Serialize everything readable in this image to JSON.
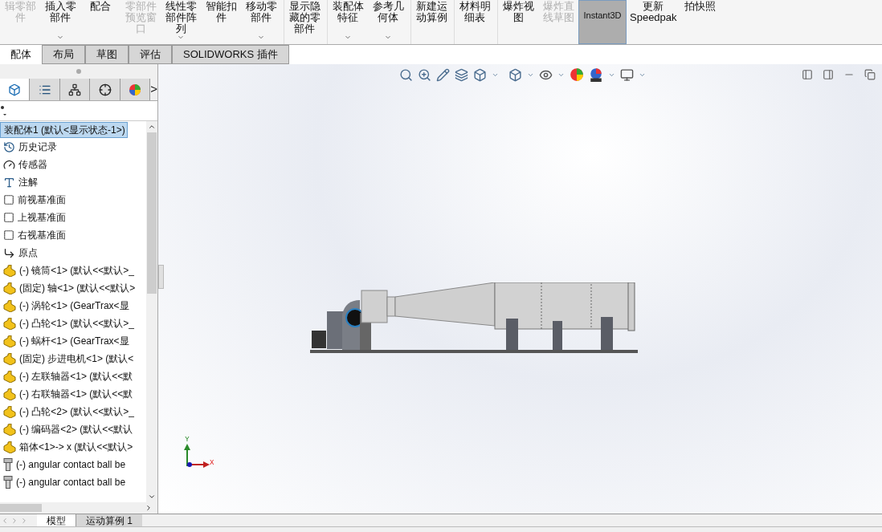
{
  "ribbon": [
    {
      "label": "辑零部件",
      "disabled": true,
      "dropdown": false,
      "selected": false
    },
    {
      "label": "插入零部件",
      "disabled": false,
      "dropdown": true,
      "selected": false
    },
    {
      "label": "配合",
      "disabled": false,
      "dropdown": false,
      "selected": false
    },
    {
      "label": "零部件预览窗口",
      "disabled": true,
      "dropdown": false,
      "selected": false
    },
    {
      "label": "线性零部件阵列",
      "disabled": false,
      "dropdown": true,
      "selected": false
    },
    {
      "label": "智能扣件",
      "disabled": false,
      "dropdown": false,
      "selected": false
    },
    {
      "label": "移动零部件",
      "disabled": false,
      "dropdown": true,
      "selected": false
    },
    {
      "label": "显示隐藏的零部件",
      "disabled": false,
      "dropdown": false,
      "selected": false
    },
    {
      "label": "装配体特征",
      "disabled": false,
      "dropdown": true,
      "selected": false
    },
    {
      "label": "参考几何体",
      "disabled": false,
      "dropdown": true,
      "selected": false
    },
    {
      "label": "新建运动算例",
      "disabled": false,
      "dropdown": false,
      "selected": false
    },
    {
      "label": "材料明细表",
      "disabled": false,
      "dropdown": false,
      "selected": false
    },
    {
      "label": "爆炸视图",
      "disabled": false,
      "dropdown": false,
      "selected": false
    },
    {
      "label": "爆炸直线草图",
      "disabled": true,
      "dropdown": false,
      "selected": false
    },
    {
      "label": "Instant3D",
      "disabled": false,
      "dropdown": false,
      "selected": true
    },
    {
      "label": "更新Speedpak",
      "disabled": false,
      "dropdown": false,
      "selected": false
    },
    {
      "label": "拍快照",
      "disabled": false,
      "dropdown": false,
      "selected": false
    }
  ],
  "tabs": [
    {
      "label": "配体",
      "selected": true
    },
    {
      "label": "布局",
      "selected": false
    },
    {
      "label": "草图",
      "selected": false
    },
    {
      "label": "评估",
      "selected": false
    },
    {
      "label": "SOLIDWORKS 插件",
      "selected": false
    }
  ],
  "panel_tabs": [
    {
      "kind": "tree",
      "selected": true
    },
    {
      "kind": "property",
      "selected": false
    },
    {
      "kind": "config",
      "selected": false
    },
    {
      "kind": "dim",
      "selected": false
    },
    {
      "kind": "display",
      "selected": false
    }
  ],
  "panel_more": ">",
  "tree": {
    "root": {
      "label": "装配体1  (默认<显示状态-1>)",
      "selected": true
    },
    "items": [
      {
        "kind": "history",
        "label": "历史记录"
      },
      {
        "kind": "sensor",
        "label": "传感器"
      },
      {
        "kind": "annotation",
        "label": "注解"
      },
      {
        "kind": "plane",
        "label": "前视基准面"
      },
      {
        "kind": "plane",
        "label": "上视基准面"
      },
      {
        "kind": "plane",
        "label": "右视基准面"
      },
      {
        "kind": "origin",
        "label": "原点"
      },
      {
        "kind": "part",
        "label": "(-) 镜筒<1> (默认<<默认>_"
      },
      {
        "kind": "part",
        "label": "(固定) 轴<1> (默认<<默认>"
      },
      {
        "kind": "part",
        "label": "(-) 涡轮<1> (GearTrax<显"
      },
      {
        "kind": "part",
        "label": "(-) 凸轮<1> (默认<<默认>_"
      },
      {
        "kind": "part",
        "label": "(-) 蜗杆<1> (GearTrax<显"
      },
      {
        "kind": "part",
        "label": "(固定) 步进电机<1> (默认<"
      },
      {
        "kind": "part",
        "label": "(-) 左联轴器<1> (默认<<默"
      },
      {
        "kind": "part",
        "label": "(-) 右联轴器<1> (默认<<默"
      },
      {
        "kind": "part",
        "label": "(-) 凸轮<2> (默认<<默认>_"
      },
      {
        "kind": "part",
        "label": "(-) 编码器<2> (默认<<默认"
      },
      {
        "kind": "part",
        "label": "箱体<1>-> x (默认<<默认>"
      },
      {
        "kind": "bolt",
        "label": "(-) angular contact ball be"
      },
      {
        "kind": "bolt",
        "label": "(-) angular contact ball be"
      }
    ]
  },
  "bottom_tabs": [
    {
      "label": "模型",
      "selected": true
    },
    {
      "label": "运动算例 1",
      "selected": false
    }
  ],
  "triad": {
    "y": "Y",
    "x": "X"
  }
}
